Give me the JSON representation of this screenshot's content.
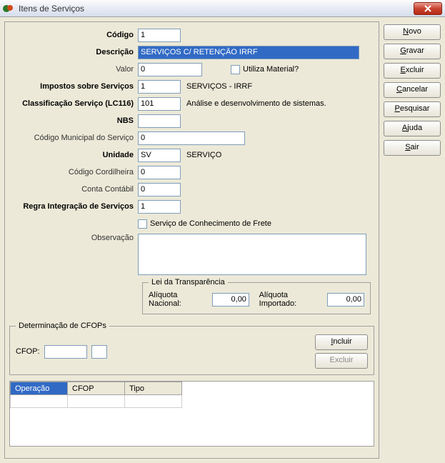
{
  "window": {
    "title": "Itens de Serviços"
  },
  "sidebar": {
    "novo": "Novo",
    "gravar": "Gravar",
    "excluir": "Excluir",
    "cancelar": "Cancelar",
    "pesquisar": "Pesquisar",
    "ajuda": "Ajuda",
    "sair": "Sair"
  },
  "form": {
    "codigo_label": "Código",
    "codigo_value": "1",
    "descricao_label": "Descrição",
    "descricao_value": "SERVIÇOS C/ RETENÇÃO IRRF",
    "valor_label": "Valor",
    "valor_value": "0",
    "utiliza_material_label": "Utiliza Material?",
    "utiliza_material_checked": false,
    "impostos_label": "Impostos sobre Serviços",
    "impostos_value": "1",
    "impostos_desc": "SERVIÇOS - IRRF",
    "classif_label": "Classificação Serviço (LC116)",
    "classif_value": "101",
    "classif_desc": "Análise e desenvolvimento de sistemas.",
    "nbs_label": "NBS",
    "nbs_value": "",
    "cod_mun_label": "Código Municipal do Serviço",
    "cod_mun_value": "0",
    "unidade_label": "Unidade",
    "unidade_value": "SV",
    "unidade_desc": "SERVIÇO",
    "cordilheira_label": "Código Cordilheira",
    "cordilheira_value": "0",
    "conta_label": "Conta Contábil",
    "conta_value": "0",
    "regra_label": "Regra Integração de Serviços",
    "regra_value": "1",
    "frete_label": "Serviço de Conhecimento de Frete",
    "frete_checked": false,
    "obs_label": "Observação",
    "obs_value": ""
  },
  "transparencia": {
    "legend": "Lei da Transparência",
    "aliq_nac_label": "Alíquota Nacional:",
    "aliq_nac_value": "0,00",
    "aliq_imp_label": "Alíquota Importado:",
    "aliq_imp_value": "0,00"
  },
  "cfop": {
    "legend": "Determinação de CFOPs",
    "cfop_label": "CFOP:",
    "cfop_value": "",
    "cfop_aux_value": "",
    "incluir": "Incluir",
    "excluir": "Excluir",
    "table": {
      "headers": [
        "Operação",
        "CFOP",
        "Tipo"
      ],
      "rows": [
        [
          "",
          "",
          ""
        ]
      ]
    }
  }
}
